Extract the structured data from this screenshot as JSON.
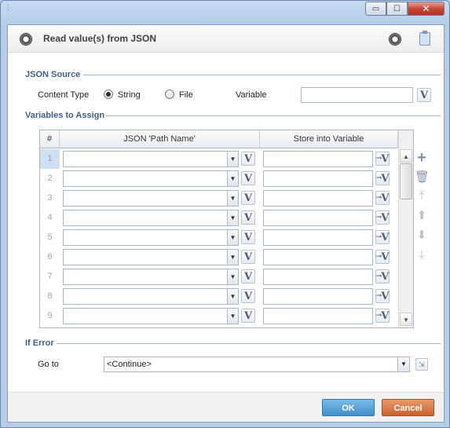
{
  "window": {
    "system_icon": "app-icon",
    "minimize": "▭",
    "maximize": "☐",
    "close": "✕"
  },
  "header": {
    "title": "Read value(s) from JSON",
    "icon": "ring-icon",
    "record_icon": "record-icon",
    "clipboard_icon": "clipboard-icon"
  },
  "json_source": {
    "section_label": "JSON Source",
    "content_type_label": "Content Type",
    "option_string": "String",
    "option_file": "File",
    "selected": "String",
    "variable_label": "Variable",
    "variable_value": "",
    "v_label": "V"
  },
  "variables": {
    "section_label": "Variables to Assign",
    "columns": [
      "#",
      "JSON 'Path Name'",
      "Store into Variable"
    ],
    "rows": [
      {
        "num": "1",
        "path": "",
        "store": ""
      },
      {
        "num": "2",
        "path": "",
        "store": ""
      },
      {
        "num": "3",
        "path": "",
        "store": ""
      },
      {
        "num": "4",
        "path": "",
        "store": ""
      },
      {
        "num": "5",
        "path": "",
        "store": ""
      },
      {
        "num": "6",
        "path": "",
        "store": ""
      },
      {
        "num": "7",
        "path": "",
        "store": ""
      },
      {
        "num": "8",
        "path": "",
        "store": ""
      },
      {
        "num": "9",
        "path": "",
        "store": ""
      }
    ],
    "selected_row": 1,
    "tools": [
      "add-icon",
      "delete-icon",
      "move-top-icon",
      "move-up-icon",
      "move-down-icon",
      "move-bottom-icon"
    ]
  },
  "if_error": {
    "section_label": "If Error",
    "goto_label": "Go to",
    "goto_value": "<Continue>"
  },
  "footer": {
    "ok": "OK",
    "cancel": "Cancel"
  },
  "colors": {
    "ok": "#3f8fcb",
    "cancel": "#c9622c",
    "section": "#3e5f86"
  }
}
